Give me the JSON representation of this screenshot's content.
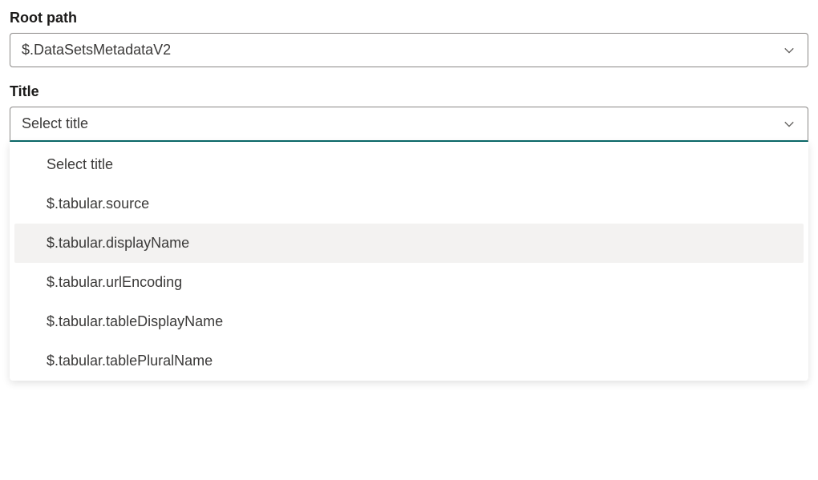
{
  "rootPath": {
    "label": "Root path",
    "value": "$.DataSetsMetadataV2"
  },
  "title": {
    "label": "Title",
    "value": "Select title",
    "options": [
      {
        "label": "Select title",
        "highlighted": false
      },
      {
        "label": "$.tabular.source",
        "highlighted": false
      },
      {
        "label": "$.tabular.displayName",
        "highlighted": true
      },
      {
        "label": "$.tabular.urlEncoding",
        "highlighted": false
      },
      {
        "label": "$.tabular.tableDisplayName",
        "highlighted": false
      },
      {
        "label": "$.tabular.tablePluralName",
        "highlighted": false
      }
    ]
  }
}
